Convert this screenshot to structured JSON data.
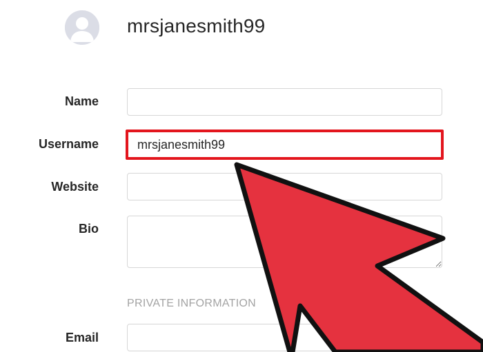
{
  "profile": {
    "username": "mrsjanesmith99",
    "avatar": "default-user-avatar-icon"
  },
  "form": {
    "name": {
      "label": "Name",
      "value": ""
    },
    "username": {
      "label": "Username",
      "value": "mrsjanesmith99"
    },
    "website": {
      "label": "Website",
      "value": ""
    },
    "bio": {
      "label": "Bio",
      "value": ""
    },
    "private_heading": "PRIVATE INFORMATION",
    "email": {
      "label": "Email",
      "value": ""
    }
  },
  "annotation": {
    "pointer": "red-arrow-icon",
    "highlight_color": "#e3151d",
    "arrow_color": "#e5323f"
  }
}
